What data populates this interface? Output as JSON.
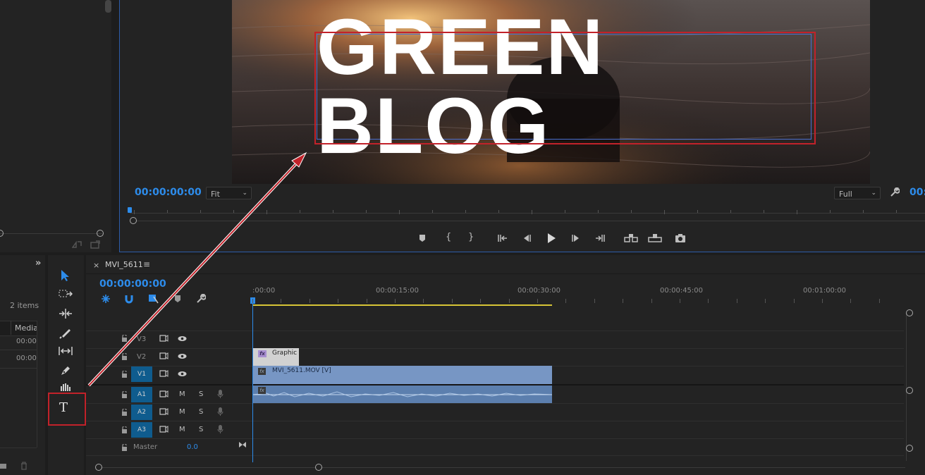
{
  "project": {
    "items_count": "2 items",
    "col_media": "Media",
    "row1": "00:00",
    "row2": "00:00"
  },
  "monitor": {
    "title_text": "GREEN BLOG",
    "timecode": "00:00:00:00",
    "fit": "Fit",
    "quality": "Full",
    "end_tc": "00:"
  },
  "timeline": {
    "sequence_tab": "MVI_5611",
    "timecode": "00:00:00:00",
    "ruler": [
      ":00:00",
      "00:00:15:00",
      "00:00:30:00",
      "00:00:45:00",
      "00:01:00:00"
    ],
    "tracks": {
      "v3": "V3",
      "v2": "V2",
      "v1": "V1",
      "a1": "A1",
      "a2": "A2",
      "a3": "A3",
      "m": "M",
      "s": "S",
      "master": "Master",
      "master_val": "0.0"
    },
    "clip_graphic": "Graphic",
    "clip_video": "MVI_5611.MOV [V]",
    "fx": "fx"
  },
  "colors": {
    "accent": "#2d8ceb",
    "highlight": "#c2222a",
    "clip_video": "#7796c4",
    "clip_audio": "#5c7fae",
    "track_button": "#0f5c8e"
  }
}
